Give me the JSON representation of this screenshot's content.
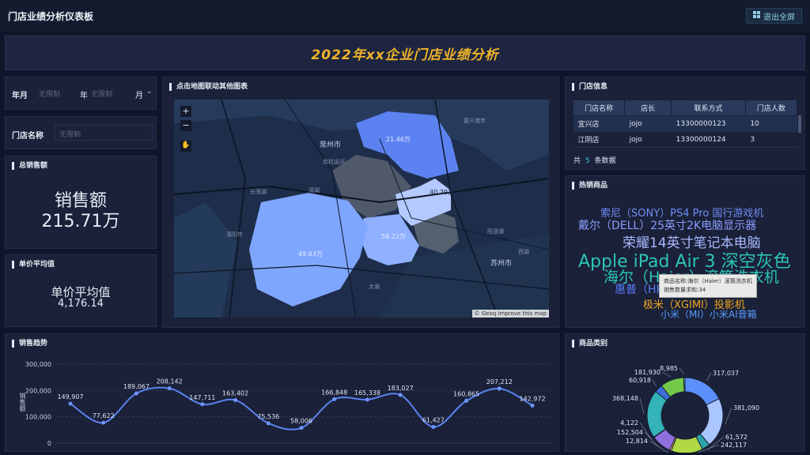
{
  "header": {
    "title": "门店业绩分析仪表板",
    "exit_label": "退出全屏"
  },
  "banner": {
    "title": "2022年xx企业门店业绩分析"
  },
  "filters": {
    "year_month": {
      "label": "年月",
      "year_placeholder": "无限制",
      "year_unit": "年",
      "month_placeholder": "无限制",
      "month_unit": "月"
    },
    "store": {
      "label": "门店名称",
      "placeholder": "无限制"
    }
  },
  "total_sales": {
    "title": "总销售额",
    "label": "销售额",
    "value": "215.71万"
  },
  "avg_price": {
    "title": "单价平均值",
    "label": "单价平均值",
    "value": "4,176.14"
  },
  "map": {
    "title": "点击地图联动其他图表",
    "attribution": "© Geoq Improve this map",
    "region_labels": [
      "21.46万",
      "40.79万",
      "58.22万",
      "49.63万"
    ],
    "place_labels": [
      "常州市",
      "苏州市",
      "嘉兴港市",
      "长荡湖",
      "滆湖",
      "溧阳市",
      "阳澄湖",
      "太湖",
      "京杭运河",
      "西湖"
    ]
  },
  "store_info": {
    "title": "门店信息",
    "columns": [
      "门店名称",
      "店长",
      "联系方式",
      "门店人数"
    ],
    "rows": [
      [
        "宜兴店",
        "jojo",
        "13300000123",
        "10"
      ],
      [
        "江阴店",
        "jojo",
        "13300000124",
        "3"
      ]
    ],
    "footer_prefix": "共",
    "footer_count": "5",
    "footer_suffix": "条数据"
  },
  "hot_products": {
    "title": "热销商品",
    "words": [
      "索尼（SONY）PS4 Pro 国行游戏机",
      "戴尔（DELL）25英寸2K电脑显示器",
      "荣耀14英寸笔记本电脑",
      "Apple iPad Air 3 深空灰色",
      "海尔（Haier）滚筒洗衣机",
      "惠普（HP）打印机",
      "极米（XGIMI）投影机",
      "小米（MI）小米AI音箱"
    ],
    "tooltip": {
      "line1": "商品名称:海尔（Haier）滚筒洗衣机",
      "line2": "销售数量求和:34"
    },
    "colors": [
      "#6a8cff",
      "#8b9cff",
      "#a9b8ff",
      "#2ec4b6",
      "#2ec4b6",
      "#5b7cfa",
      "#f0a51e",
      "#5b9cff"
    ]
  },
  "sales_trend": {
    "title": "销售趋势",
    "ylabel": "销售额",
    "yticks": [
      "300,000",
      "200,000",
      "100,000",
      "0"
    ]
  },
  "category": {
    "title": "商品类别",
    "labels": [
      "317,037",
      "381,090",
      "61,572",
      "242,117",
      "12,814",
      "152,504",
      "4,122",
      "368,148",
      "60,918",
      "181,930",
      "8,985"
    ]
  },
  "chart_data": [
    {
      "type": "line",
      "title": "销售趋势",
      "ylabel": "销售额",
      "ylim": [
        0,
        300000
      ],
      "series": [
        {
          "values": [
            149907,
            77622,
            189067,
            208142,
            147711,
            163402,
            75536,
            58006,
            166848,
            165338,
            183027,
            61427,
            160865,
            207212,
            142972
          ]
        }
      ],
      "labels": [
        "149,907",
        "77,622",
        "189,067",
        "208,142",
        "147,711",
        "163,402",
        "75,536",
        "58,006",
        "166,848",
        "165,338",
        "183,027",
        "61,427",
        "160,865",
        "207,212",
        "142,972"
      ]
    },
    {
      "type": "pie",
      "title": "商品类别",
      "values": [
        317037,
        381090,
        61572,
        242117,
        12814,
        152504,
        4122,
        368148,
        60918,
        181930,
        8985
      ],
      "colors": [
        "#5b8ff9",
        "#a9c6ff",
        "#2ca3a8",
        "#b0d943",
        "#f3cf4d",
        "#8f6fde",
        "#ef7b5e",
        "#34b3b8",
        "#3d6fd8",
        "#74c94a",
        "#99e1e6"
      ]
    }
  ]
}
